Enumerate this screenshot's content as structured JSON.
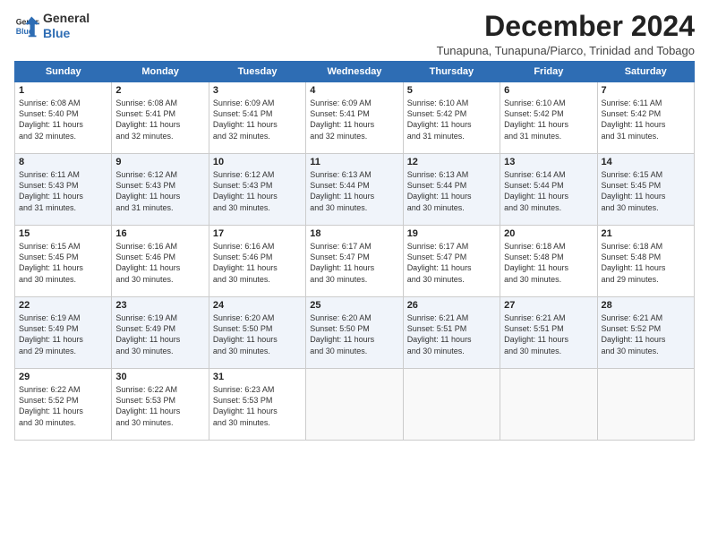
{
  "header": {
    "logo_line1": "General",
    "logo_line2": "Blue",
    "month": "December 2024",
    "location": "Tunapuna, Tunapuna/Piarco, Trinidad and Tobago"
  },
  "days_of_week": [
    "Sunday",
    "Monday",
    "Tuesday",
    "Wednesday",
    "Thursday",
    "Friday",
    "Saturday"
  ],
  "weeks": [
    [
      {
        "day": "1",
        "lines": [
          "Sunrise: 6:08 AM",
          "Sunset: 5:40 PM",
          "Daylight: 11 hours",
          "and 32 minutes."
        ]
      },
      {
        "day": "2",
        "lines": [
          "Sunrise: 6:08 AM",
          "Sunset: 5:41 PM",
          "Daylight: 11 hours",
          "and 32 minutes."
        ]
      },
      {
        "day": "3",
        "lines": [
          "Sunrise: 6:09 AM",
          "Sunset: 5:41 PM",
          "Daylight: 11 hours",
          "and 32 minutes."
        ]
      },
      {
        "day": "4",
        "lines": [
          "Sunrise: 6:09 AM",
          "Sunset: 5:41 PM",
          "Daylight: 11 hours",
          "and 32 minutes."
        ]
      },
      {
        "day": "5",
        "lines": [
          "Sunrise: 6:10 AM",
          "Sunset: 5:42 PM",
          "Daylight: 11 hours",
          "and 31 minutes."
        ]
      },
      {
        "day": "6",
        "lines": [
          "Sunrise: 6:10 AM",
          "Sunset: 5:42 PM",
          "Daylight: 11 hours",
          "and 31 minutes."
        ]
      },
      {
        "day": "7",
        "lines": [
          "Sunrise: 6:11 AM",
          "Sunset: 5:42 PM",
          "Daylight: 11 hours",
          "and 31 minutes."
        ]
      }
    ],
    [
      {
        "day": "8",
        "lines": [
          "Sunrise: 6:11 AM",
          "Sunset: 5:43 PM",
          "Daylight: 11 hours",
          "and 31 minutes."
        ]
      },
      {
        "day": "9",
        "lines": [
          "Sunrise: 6:12 AM",
          "Sunset: 5:43 PM",
          "Daylight: 11 hours",
          "and 31 minutes."
        ]
      },
      {
        "day": "10",
        "lines": [
          "Sunrise: 6:12 AM",
          "Sunset: 5:43 PM",
          "Daylight: 11 hours",
          "and 30 minutes."
        ]
      },
      {
        "day": "11",
        "lines": [
          "Sunrise: 6:13 AM",
          "Sunset: 5:44 PM",
          "Daylight: 11 hours",
          "and 30 minutes."
        ]
      },
      {
        "day": "12",
        "lines": [
          "Sunrise: 6:13 AM",
          "Sunset: 5:44 PM",
          "Daylight: 11 hours",
          "and 30 minutes."
        ]
      },
      {
        "day": "13",
        "lines": [
          "Sunrise: 6:14 AM",
          "Sunset: 5:44 PM",
          "Daylight: 11 hours",
          "and 30 minutes."
        ]
      },
      {
        "day": "14",
        "lines": [
          "Sunrise: 6:15 AM",
          "Sunset: 5:45 PM",
          "Daylight: 11 hours",
          "and 30 minutes."
        ]
      }
    ],
    [
      {
        "day": "15",
        "lines": [
          "Sunrise: 6:15 AM",
          "Sunset: 5:45 PM",
          "Daylight: 11 hours",
          "and 30 minutes."
        ]
      },
      {
        "day": "16",
        "lines": [
          "Sunrise: 6:16 AM",
          "Sunset: 5:46 PM",
          "Daylight: 11 hours",
          "and 30 minutes."
        ]
      },
      {
        "day": "17",
        "lines": [
          "Sunrise: 6:16 AM",
          "Sunset: 5:46 PM",
          "Daylight: 11 hours",
          "and 30 minutes."
        ]
      },
      {
        "day": "18",
        "lines": [
          "Sunrise: 6:17 AM",
          "Sunset: 5:47 PM",
          "Daylight: 11 hours",
          "and 30 minutes."
        ]
      },
      {
        "day": "19",
        "lines": [
          "Sunrise: 6:17 AM",
          "Sunset: 5:47 PM",
          "Daylight: 11 hours",
          "and 30 minutes."
        ]
      },
      {
        "day": "20",
        "lines": [
          "Sunrise: 6:18 AM",
          "Sunset: 5:48 PM",
          "Daylight: 11 hours",
          "and 30 minutes."
        ]
      },
      {
        "day": "21",
        "lines": [
          "Sunrise: 6:18 AM",
          "Sunset: 5:48 PM",
          "Daylight: 11 hours",
          "and 29 minutes."
        ]
      }
    ],
    [
      {
        "day": "22",
        "lines": [
          "Sunrise: 6:19 AM",
          "Sunset: 5:49 PM",
          "Daylight: 11 hours",
          "and 29 minutes."
        ]
      },
      {
        "day": "23",
        "lines": [
          "Sunrise: 6:19 AM",
          "Sunset: 5:49 PM",
          "Daylight: 11 hours",
          "and 30 minutes."
        ]
      },
      {
        "day": "24",
        "lines": [
          "Sunrise: 6:20 AM",
          "Sunset: 5:50 PM",
          "Daylight: 11 hours",
          "and 30 minutes."
        ]
      },
      {
        "day": "25",
        "lines": [
          "Sunrise: 6:20 AM",
          "Sunset: 5:50 PM",
          "Daylight: 11 hours",
          "and 30 minutes."
        ]
      },
      {
        "day": "26",
        "lines": [
          "Sunrise: 6:21 AM",
          "Sunset: 5:51 PM",
          "Daylight: 11 hours",
          "and 30 minutes."
        ]
      },
      {
        "day": "27",
        "lines": [
          "Sunrise: 6:21 AM",
          "Sunset: 5:51 PM",
          "Daylight: 11 hours",
          "and 30 minutes."
        ]
      },
      {
        "day": "28",
        "lines": [
          "Sunrise: 6:21 AM",
          "Sunset: 5:52 PM",
          "Daylight: 11 hours",
          "and 30 minutes."
        ]
      }
    ],
    [
      {
        "day": "29",
        "lines": [
          "Sunrise: 6:22 AM",
          "Sunset: 5:52 PM",
          "Daylight: 11 hours",
          "and 30 minutes."
        ]
      },
      {
        "day": "30",
        "lines": [
          "Sunrise: 6:22 AM",
          "Sunset: 5:53 PM",
          "Daylight: 11 hours",
          "and 30 minutes."
        ]
      },
      {
        "day": "31",
        "lines": [
          "Sunrise: 6:23 AM",
          "Sunset: 5:53 PM",
          "Daylight: 11 hours",
          "and 30 minutes."
        ]
      },
      {
        "day": "",
        "lines": []
      },
      {
        "day": "",
        "lines": []
      },
      {
        "day": "",
        "lines": []
      },
      {
        "day": "",
        "lines": []
      }
    ]
  ]
}
